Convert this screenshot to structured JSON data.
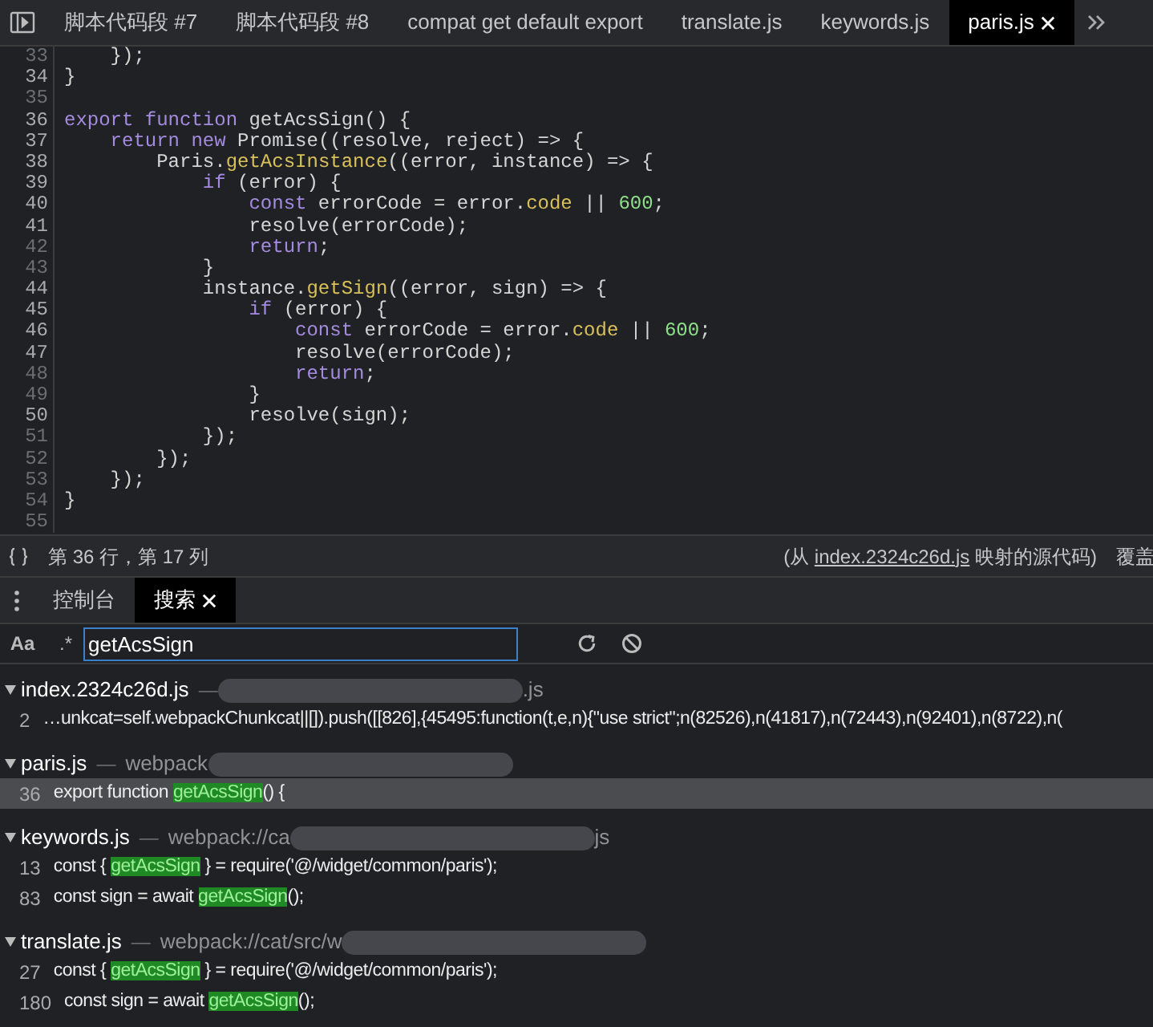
{
  "editor_tabs": [
    {
      "label": "脚本代码段 #7",
      "selected": false,
      "closable": false
    },
    {
      "label": "脚本代码段 #8",
      "selected": false,
      "closable": false
    },
    {
      "label": "compat get default export",
      "selected": false,
      "closable": false
    },
    {
      "label": "translate.js",
      "selected": false,
      "closable": false
    },
    {
      "label": "keywords.js",
      "selected": false,
      "closable": false
    },
    {
      "label": "paris.js",
      "selected": true,
      "closable": true
    }
  ],
  "code_lines": [
    {
      "number": "33",
      "dimmed": true,
      "tokens": [
        {
          "kind": "plain",
          "text": "    });"
        }
      ]
    },
    {
      "number": "34",
      "dimmed": false,
      "tokens": [
        {
          "kind": "plain",
          "text": "}"
        }
      ]
    },
    {
      "number": "35",
      "dimmed": true
    },
    {
      "number": "36",
      "dimmed": false,
      "tokens": [
        {
          "kind": "keyword",
          "text": "export function"
        },
        {
          "kind": "plain",
          "text": " getAcsSign() {"
        }
      ]
    },
    {
      "number": "37",
      "dimmed": false,
      "tokens": [
        {
          "kind": "keyword",
          "text": "    return new"
        },
        {
          "kind": "plain",
          "text": " Promise((resolve, reject) => {"
        }
      ]
    },
    {
      "number": "38",
      "dimmed": false,
      "tokens": [
        {
          "kind": "plain",
          "text": "        Paris."
        },
        {
          "kind": "method",
          "text": "getAcsInstance"
        },
        {
          "kind": "plain",
          "text": "((error, instance) => {"
        }
      ]
    },
    {
      "number": "39",
      "dimmed": false,
      "tokens": [
        {
          "kind": "keyword",
          "text": "            if"
        },
        {
          "kind": "plain",
          "text": " (error) {"
        }
      ]
    },
    {
      "number": "40",
      "dimmed": false,
      "tokens": [
        {
          "kind": "keyword",
          "text": "                const"
        },
        {
          "kind": "plain",
          "text": " errorCode = error."
        },
        {
          "kind": "method",
          "text": "code"
        },
        {
          "kind": "plain",
          "text": " || "
        },
        {
          "kind": "number",
          "text": "600"
        },
        {
          "kind": "plain",
          "text": ";"
        }
      ]
    },
    {
      "number": "41",
      "dimmed": false,
      "tokens": [
        {
          "kind": "plain",
          "text": "                resolve(errorCode);"
        }
      ]
    },
    {
      "number": "42",
      "dimmed": true,
      "tokens": [
        {
          "kind": "keyword",
          "text": "                return"
        },
        {
          "kind": "plain",
          "text": ";"
        }
      ]
    },
    {
      "number": "43",
      "dimmed": true,
      "tokens": [
        {
          "kind": "plain",
          "text": "            }"
        }
      ]
    },
    {
      "number": "44",
      "dimmed": false,
      "tokens": [
        {
          "kind": "plain",
          "text": "            instance."
        },
        {
          "kind": "method",
          "text": "getSign"
        },
        {
          "kind": "plain",
          "text": "((error, sign) => {"
        }
      ]
    },
    {
      "number": "45",
      "dimmed": false,
      "tokens": [
        {
          "kind": "keyword",
          "text": "                if"
        },
        {
          "kind": "plain",
          "text": " (error) {"
        }
      ]
    },
    {
      "number": "46",
      "dimmed": false,
      "tokens": [
        {
          "kind": "keyword",
          "text": "                    const"
        },
        {
          "kind": "plain",
          "text": " errorCode = error."
        },
        {
          "kind": "method",
          "text": "code"
        },
        {
          "kind": "plain",
          "text": " || "
        },
        {
          "kind": "number",
          "text": "600"
        },
        {
          "kind": "plain",
          "text": ";"
        }
      ]
    },
    {
      "number": "47",
      "dimmed": false,
      "tokens": [
        {
          "kind": "plain",
          "text": "                    resolve(errorCode);"
        }
      ]
    },
    {
      "number": "48",
      "dimmed": true,
      "tokens": [
        {
          "kind": "keyword",
          "text": "                    return"
        },
        {
          "kind": "plain",
          "text": ";"
        }
      ]
    },
    {
      "number": "49",
      "dimmed": true,
      "tokens": [
        {
          "kind": "plain",
          "text": "                }"
        }
      ]
    },
    {
      "number": "50",
      "dimmed": false,
      "tokens": [
        {
          "kind": "plain",
          "text": "                resolve(sign);"
        }
      ]
    },
    {
      "number": "51",
      "dimmed": true,
      "tokens": [
        {
          "kind": "plain",
          "text": "            });"
        }
      ]
    },
    {
      "number": "52",
      "dimmed": true,
      "tokens": [
        {
          "kind": "plain",
          "text": "        });"
        }
      ]
    },
    {
      "number": "53",
      "dimmed": true,
      "tokens": [
        {
          "kind": "plain",
          "text": "    });"
        }
      ]
    },
    {
      "number": "54",
      "dimmed": true,
      "tokens": [
        {
          "kind": "plain",
          "text": "}"
        }
      ]
    },
    {
      "number": "55",
      "dimmed": true
    }
  ],
  "status_bar": {
    "position": "第 36 行，第 17 列",
    "source_prefix": "(从",
    "source_link": "index.2324c26d.js",
    "source_suffix": "映射的源代码)",
    "coverage": "覆盖"
  },
  "drawer_tabs": [
    {
      "label": "控制台",
      "selected": false,
      "closable": false
    },
    {
      "label": "搜索",
      "selected": true,
      "closable": true
    }
  ],
  "search": {
    "case_toggle": "Aa",
    "regex_toggle": ".*",
    "value": "getAcsSign"
  },
  "results": [
    {
      "file": "index.2324c26d.js",
      "separator": "—",
      "path_end": ".js",
      "matches": [
        {
          "line": "2",
          "selected": false,
          "segments": [
            {
              "kind": "text",
              "text": "…unkcat=self.webpackChunkcat||[]).push([[826],{45495:function(t,e,n){\"use strict\";n(82526),n(41817),n(72443),n(92401),n(8722),n("
            }
          ]
        }
      ]
    },
    {
      "file": "paris.js",
      "separator": "—",
      "path_start": "webpack",
      "matches": [
        {
          "line": "36",
          "selected": true,
          "segments": [
            {
              "kind": "text",
              "text": "export function "
            },
            {
              "kind": "match",
              "text": "getAcsSign"
            },
            {
              "kind": "text",
              "text": "() {"
            }
          ]
        }
      ]
    },
    {
      "file": "keywords.js",
      "separator": "—",
      "path_start": "webpack://ca",
      "path_end": "js",
      "matches": [
        {
          "line": "13",
          "selected": false,
          "segments": [
            {
              "kind": "text",
              "text": "const { "
            },
            {
              "kind": "match",
              "text": "getAcsSign"
            },
            {
              "kind": "text",
              "text": " } = require('@/widget/common/paris');"
            }
          ]
        },
        {
          "line": "83",
          "selected": false,
          "segments": [
            {
              "kind": "text",
              "text": "const sign = await "
            },
            {
              "kind": "match",
              "text": "getAcsSign"
            },
            {
              "kind": "text",
              "text": "();"
            }
          ]
        }
      ]
    },
    {
      "file": "translate.js",
      "separator": "—",
      "path_start": "webpack://cat/src/w",
      "matches": [
        {
          "line": "27",
          "selected": false,
          "segments": [
            {
              "kind": "text",
              "text": "const { "
            },
            {
              "kind": "match",
              "text": "getAcsSign"
            },
            {
              "kind": "text",
              "text": " } = require('@/widget/common/paris');"
            }
          ]
        },
        {
          "line": "180",
          "selected": false,
          "segments": [
            {
              "kind": "text",
              "text": "const sign = await "
            },
            {
              "kind": "match",
              "text": "getAcsSign"
            },
            {
              "kind": "text",
              "text": "();"
            }
          ]
        }
      ]
    }
  ]
}
